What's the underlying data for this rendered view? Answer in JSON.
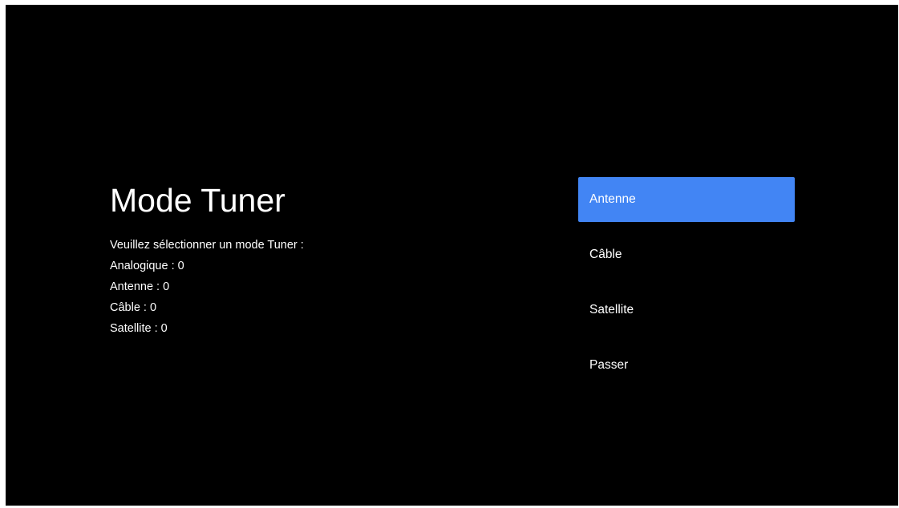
{
  "page": {
    "title": "Mode Tuner",
    "info_lines": [
      "Veuillez sélectionner un mode Tuner :",
      "Analogique : 0",
      "Antenne : 0",
      "Câble : 0",
      "Satellite : 0"
    ]
  },
  "menu": {
    "items": [
      {
        "label": "Antenne",
        "focused": true
      },
      {
        "label": "Câble",
        "focused": false
      },
      {
        "label": "Satellite",
        "focused": false
      },
      {
        "label": "Passer",
        "focused": false
      }
    ]
  },
  "colors": {
    "background": "#000000",
    "text": "#ffffff",
    "focus": "#4285f4"
  }
}
